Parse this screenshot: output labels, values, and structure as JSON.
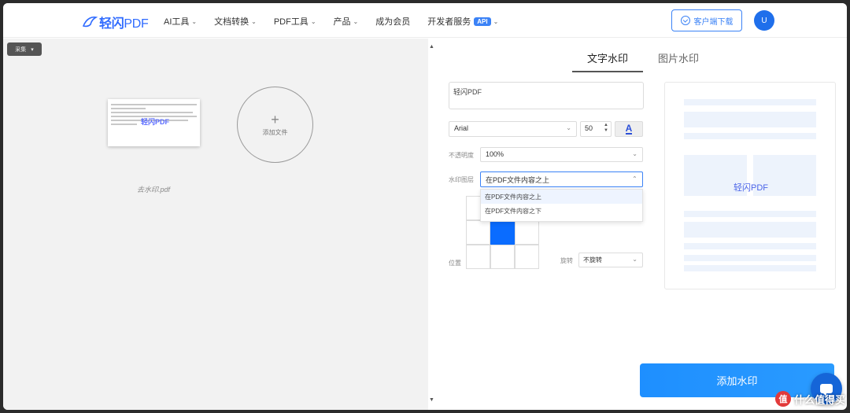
{
  "header": {
    "logo_text": "轻闪",
    "logo_suffix": "PDF",
    "nav": [
      {
        "label": "AI工具",
        "has_menu": true
      },
      {
        "label": "文档转换",
        "has_menu": true
      },
      {
        "label": "PDF工具",
        "has_menu": true
      },
      {
        "label": "产品",
        "has_menu": true
      },
      {
        "label": "成为会员",
        "has_menu": false
      },
      {
        "label": "开发者服务",
        "has_menu": true,
        "badge": "API"
      }
    ],
    "download_label": "客户端下载",
    "avatar_letter": "U"
  },
  "left": {
    "zoom_label": "采集",
    "zoom_chev": "▾",
    "thumbnail_watermark": "轻闪PDF",
    "file_name": "去水印.pdf",
    "add_file_plus": "+",
    "add_file_label": "添加文件"
  },
  "tabs": [
    {
      "label": "文字水印",
      "active": true
    },
    {
      "label": "图片水印",
      "active": false
    }
  ],
  "form": {
    "watermark_text": "轻闪PDF",
    "font": "Arial",
    "font_size": "50",
    "color_glyph": "A",
    "opacity_label": "不透明度",
    "opacity_value": "100%",
    "layer_label": "水印图层",
    "layer_value": "在PDF文件内容之上",
    "layer_options": [
      "在PDF文件内容之上",
      "在PDF文件内容之下"
    ],
    "position_label": "位置",
    "selected_cell": 4,
    "rotation_label": "旋转",
    "rotation_value": "不旋转"
  },
  "preview": {
    "watermark_text": "轻闪PDF"
  },
  "actions": {
    "submit_label": "添加水印"
  },
  "corner": {
    "badge": "值",
    "text": "什么值得买"
  },
  "colors": {
    "brand": "#2f6bff",
    "primary_button": "#1e8fff",
    "selected_cell": "#0a6cff"
  }
}
